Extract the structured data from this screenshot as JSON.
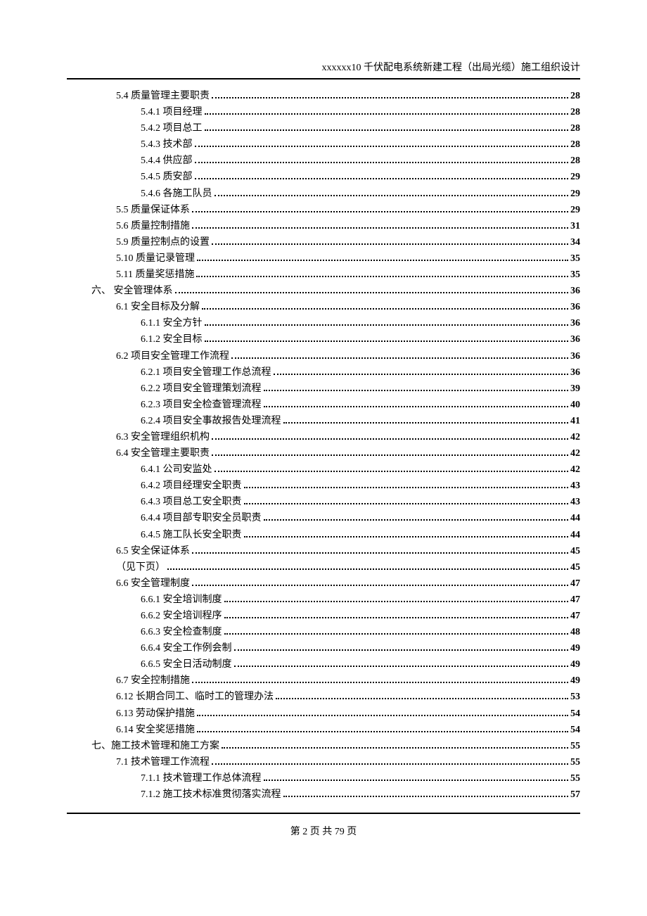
{
  "header": "xxxxxx10 千伏配电系统新建工程（出局光缆）施工组织设计",
  "footer": "第 2 页 共 79 页",
  "toc": [
    {
      "label": "5.4 质量管理主要职责",
      "page": "28",
      "indent": 1
    },
    {
      "label": "5.4.1 项目经理",
      "page": "28",
      "indent": 2
    },
    {
      "label": "5.4.2 项目总工",
      "page": "28",
      "indent": 2
    },
    {
      "label": "5.4.3 技术部",
      "page": "28",
      "indent": 2
    },
    {
      "label": "5.4.4 供应部",
      "page": "28",
      "indent": 2
    },
    {
      "label": "5.4.5 质安部",
      "page": "29",
      "indent": 2
    },
    {
      "label": "5.4.6 各施工队员",
      "page": "29",
      "indent": 2
    },
    {
      "label": "5.5 质量保证体系",
      "page": "29",
      "indent": 1
    },
    {
      "label": "5.6 质量控制措施",
      "page": "31",
      "indent": 1
    },
    {
      "label": "5.9  质量控制点的设置",
      "page": "34",
      "indent": 1
    },
    {
      "label": "5.10 质量记录管理",
      "page": "35",
      "indent": 1
    },
    {
      "label": "5.11 质量奖惩措施",
      "page": "35",
      "indent": 1
    },
    {
      "label": "六、 安全管理体系",
      "page": "36",
      "indent": 0
    },
    {
      "label": "6.1 安全目标及分解",
      "page": "36",
      "indent": 1
    },
    {
      "label": "6.1.1 安全方针",
      "page": "36",
      "indent": 2
    },
    {
      "label": "6.1.2 安全目标",
      "page": "36",
      "indent": 2
    },
    {
      "label": "6.2 项目安全管理工作流程",
      "page": "36",
      "indent": 1
    },
    {
      "label": "6.2.1 项目安全管理工作总流程",
      "page": "36",
      "indent": 2
    },
    {
      "label": "6.2.2 项目安全管理策划流程",
      "page": "39",
      "indent": 2
    },
    {
      "label": "6.2.3 项目安全检查管理流程",
      "page": "40",
      "indent": 2
    },
    {
      "label": "6.2.4 项目安全事故报告处理流程",
      "page": "41",
      "indent": 2
    },
    {
      "label": "6.3 安全管理组织机构",
      "page": "42",
      "indent": 1
    },
    {
      "label": "6.4 安全管理主要职责",
      "page": "42",
      "indent": 1
    },
    {
      "label": "6.4.1 公司安监处",
      "page": "42",
      "indent": 2
    },
    {
      "label": "6.4.2 项目经理安全职责",
      "page": "43",
      "indent": 2
    },
    {
      "label": "6.4.3 项目总工安全职责",
      "page": "43",
      "indent": 2
    },
    {
      "label": "6.4.4 项目部专职安全员职责",
      "page": "44",
      "indent": 2
    },
    {
      "label": "6.4.5 施工队长安全职责",
      "page": "44",
      "indent": 2
    },
    {
      "label": "6.5 安全保证体系",
      "page": "45",
      "indent": 1
    },
    {
      "label": "（见下页）",
      "page": "45",
      "indent": 1
    },
    {
      "label": "6.6 安全管理制度",
      "page": "47",
      "indent": 1
    },
    {
      "label": "6.6.1 安全培训制度",
      "page": "47",
      "indent": 2
    },
    {
      "label": "6.6.2 安全培训程序",
      "page": "47",
      "indent": 2
    },
    {
      "label": "6.6.3 安全检查制度",
      "page": "48",
      "indent": 2
    },
    {
      "label": "6.6.4 安全工作例会制",
      "page": "49",
      "indent": 2
    },
    {
      "label": "6.6.5 安全日活动制度",
      "page": "49",
      "indent": 2
    },
    {
      "label": "6.7 安全控制措施",
      "page": "49",
      "indent": 1
    },
    {
      "label": "6.12 长期合同工、临时工的管理办法",
      "page": "53",
      "indent": 1
    },
    {
      "label": "6.13 劳动保护措施",
      "page": "54",
      "indent": 1
    },
    {
      "label": "6.14 安全奖惩措施",
      "page": "54",
      "indent": 1
    },
    {
      "label": "七、施工技术管理和施工方案",
      "page": "55",
      "indent": 0
    },
    {
      "label": "7.1 技术管理工作流程",
      "page": "55",
      "indent": 1
    },
    {
      "label": "7.1.1 技术管理工作总体流程",
      "page": "55",
      "indent": 2
    },
    {
      "label": "7.1.2 施工技术标准贯彻落实流程",
      "page": "57",
      "indent": 2
    }
  ]
}
